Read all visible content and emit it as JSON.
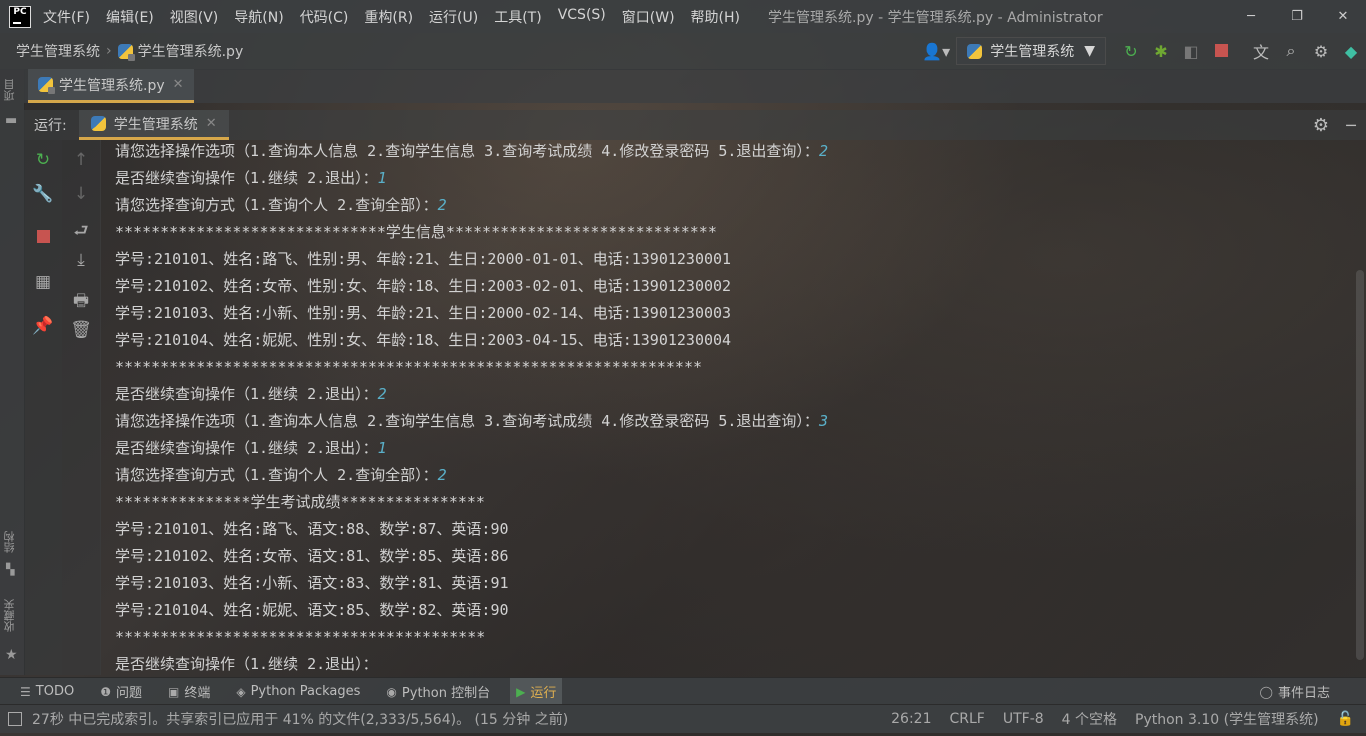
{
  "menubar": {
    "items": [
      "文件(F)",
      "编辑(E)",
      "视图(V)",
      "导航(N)",
      "代码(C)",
      "重构(R)",
      "运行(U)",
      "工具(T)",
      "VCS(S)",
      "窗口(W)",
      "帮助(H)"
    ],
    "window_title": "学生管理系统.py - 学生管理系统.py - Administrator",
    "minimize": "─",
    "restore": "❐",
    "close": "✕"
  },
  "navbar": {
    "project": "学生管理系统",
    "file": "学生管理系统.py",
    "run_config": "学生管理系统"
  },
  "editor_tab": {
    "label": "学生管理系统.py",
    "close": "✕"
  },
  "run_panel": {
    "label": "运行:",
    "tab": "学生管理系统",
    "close": "✕"
  },
  "left_strip": {
    "project_label": "项目",
    "structure_label": "结构",
    "favorites_label": "收藏夹"
  },
  "console": {
    "lines": [
      {
        "text": "请您选择操作选项（1.查询本人信息 2.查询学生信息 3.查询考试成绩 4.修改登录密码 5.退出查询）：",
        "input": "2"
      },
      {
        "text": "是否继续查询操作（1.继续 2.退出）：",
        "input": "1"
      },
      {
        "text": "请您选择查询方式（1.查询个人 2.查询全部）：",
        "input": "2"
      },
      {
        "text": "******************************学生信息******************************",
        "input": ""
      },
      {
        "text": "学号:210101、姓名:路飞、性别:男、年龄:21、生日:2000-01-01、电话:13901230001",
        "input": ""
      },
      {
        "text": "学号:210102、姓名:女帝、性别:女、年龄:18、生日:2003-02-01、电话:13901230002",
        "input": ""
      },
      {
        "text": "学号:210103、姓名:小新、性别:男、年龄:21、生日:2000-02-14、电话:13901230003",
        "input": ""
      },
      {
        "text": "学号:210104、姓名:妮妮、性别:女、年龄:18、生日:2003-04-15、电话:13901230004",
        "input": ""
      },
      {
        "text": "*****************************************************************",
        "input": ""
      },
      {
        "text": "是否继续查询操作（1.继续 2.退出）：",
        "input": "2"
      },
      {
        "text": "请您选择操作选项（1.查询本人信息 2.查询学生信息 3.查询考试成绩 4.修改登录密码 5.退出查询）：",
        "input": "3"
      },
      {
        "text": "是否继续查询操作（1.继续 2.退出）：",
        "input": "1"
      },
      {
        "text": "请您选择查询方式（1.查询个人 2.查询全部）：",
        "input": "2"
      },
      {
        "text": "***************学生考试成绩****************",
        "input": ""
      },
      {
        "text": "学号:210101、姓名:路飞、语文:88、数学:87、英语:90",
        "input": ""
      },
      {
        "text": "学号:210102、姓名:女帝、语文:81、数学:85、英语:86",
        "input": ""
      },
      {
        "text": "学号:210103、姓名:小新、语文:83、数学:81、英语:91",
        "input": ""
      },
      {
        "text": "学号:210104、姓名:妮妮、语文:85、数学:82、英语:90",
        "input": ""
      },
      {
        "text": "*****************************************",
        "input": ""
      },
      {
        "text": "是否继续查询操作（1.继续 2.退出）：",
        "input": ""
      }
    ]
  },
  "tool_tabs": [
    {
      "icon": "☰",
      "label": "TODO",
      "name": "todo"
    },
    {
      "icon": "❶",
      "label": "问题",
      "name": "problems"
    },
    {
      "icon": "▣",
      "label": "终端",
      "name": "terminal"
    },
    {
      "icon": "◈",
      "label": "Python Packages",
      "name": "python-packages"
    },
    {
      "icon": "◉",
      "label": "Python 控制台",
      "name": "python-console"
    },
    {
      "icon": "▶",
      "label": "运行",
      "name": "run",
      "active": true
    }
  ],
  "event_log": "事件日志",
  "statusbar": {
    "message": "27秒 中已完成索引。共享索引已应用于 41% 的文件(2,333/5,564)。 (15 分钟 之前)",
    "position": "26:21",
    "line_sep": "CRLF",
    "encoding": "UTF-8",
    "indent": "4 个空格",
    "interpreter": "Python 3.10 (学生管理系统)"
  }
}
